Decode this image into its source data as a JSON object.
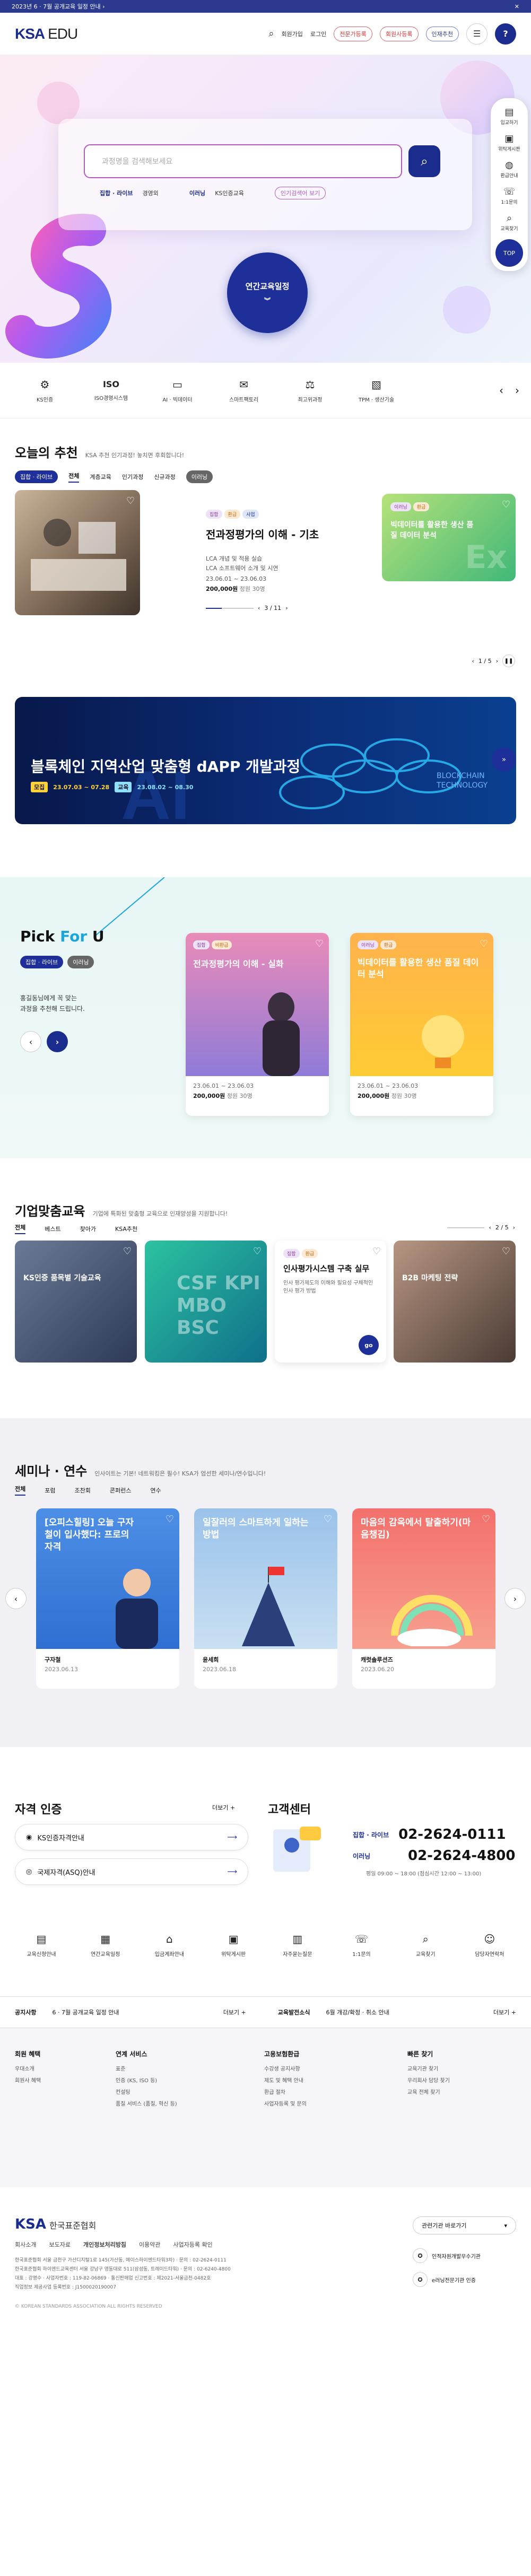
{
  "topbar": {
    "notice": "2023년 6 · 7월 공개교육 일정 안내 ›",
    "close": "✕"
  },
  "header": {
    "logo_main": "KSA",
    "logo_sub": "EDU",
    "menu": [
      "회원가입",
      "로그인"
    ],
    "pill1": "전문가등록",
    "pill2": "회원사등록",
    "pill3": "인재추천",
    "help": "?"
  },
  "hero": {
    "placeholder": "과정명을 검색해보세요",
    "tags": [
      "집합 · 라이브",
      "경영외",
      "이러닝",
      "KS인증교육"
    ],
    "tag_btn": "인기검색어 보기",
    "year_btn": "연간교육일정",
    "year_arrow": "︾"
  },
  "sidebar": [
    {
      "icon": "▤",
      "label": "입교하기"
    },
    {
      "icon": "▣",
      "label": "위탁게시판"
    },
    {
      "icon": "◍",
      "label": "환급안내"
    },
    {
      "icon": "☏",
      "label": "1:1문의"
    },
    {
      "icon": "⌕",
      "label": "교육찾기"
    }
  ],
  "sidebar_top": "TOP",
  "categories": [
    {
      "icon": "⚙",
      "label": "KS인증"
    },
    {
      "icon": "ISO",
      "label": "ISO경영시스템"
    },
    {
      "icon": "▭",
      "label": "AI · 빅데이터"
    },
    {
      "icon": "✉",
      "label": "스마트팩토리"
    },
    {
      "icon": "⚖",
      "label": "최고위과정"
    },
    {
      "icon": "▧",
      "label": "TPM · 생산기술"
    }
  ],
  "today": {
    "title": "오늘의 추천",
    "subtitle": "KSA 추천 인기과정! 놓치면 후회합니다!",
    "sel1": "집합 · 라이브",
    "sel2": "이러닝",
    "tabs": [
      "전체",
      "계층교육",
      "인기과정",
      "신규과정"
    ],
    "main": {
      "badges": [
        "집합",
        "환급",
        "사업"
      ],
      "title": "전과정평가의 이해 - 기초",
      "desc1": "LCA 개념 및 적용 실습",
      "desc2": "LCA 소프트웨어 소개 및 시연",
      "date": "23.06.01 ~ 23.06.03",
      "price": "200,000원",
      "hours": "정원 30명",
      "page": "3 / 11"
    },
    "side": {
      "badges": [
        "이러닝",
        "환급"
      ],
      "title": "빅데이터를 활용한 생산 품질 데이터 분석"
    },
    "pager": "1 / 5"
  },
  "banner": {
    "title": "블록체인 지역산업 맞춤형 dAPP 개발과정",
    "tag1": "모집",
    "date1": "23.07.03 ~ 07.28",
    "tag2": "교육",
    "date2": "23.08.02 ~ 08.30",
    "bg_text": "BLOCKCHAIN TECHNOLOGY"
  },
  "pick": {
    "title_a": "Pick ",
    "title_b": "For ",
    "title_c": "U",
    "sel1": "집합 · 라이브",
    "sel2": "이러닝",
    "desc1": "홍길동님에게 꼭 맞는",
    "desc2": "과정을 추천해 드립니다.",
    "cards": [
      {
        "badges": [
          "집합",
          "비환급"
        ],
        "title": "전과정평가의 이해 - 실화",
        "date": "23.06.01 ~ 23.06.03",
        "price": "200,000원",
        "cap": "정원 30명"
      },
      {
        "badges": [
          "이러닝",
          "환급"
        ],
        "title": "빅데이터를 활용한 생산 품질 데이터 분석",
        "date": "23.06.01 ~ 23.06.03",
        "price": "200,000원",
        "cap": "정원 30명"
      }
    ]
  },
  "corp": {
    "title": "기업맞춤교육",
    "sub": "기업에 특화된 맞춤형 교육으로 인재양성을 지원합니다!",
    "tabs": [
      "전체",
      "베스트",
      "찾아가",
      "KSA추천"
    ],
    "page": "2 / 5",
    "cards": [
      {
        "title": "KS인증 품목별 기술교육"
      },
      {
        "title": "CSF KPI MBO BSC"
      },
      {
        "badges": [
          "집합",
          "환급"
        ],
        "title": "인사평가시스템 구축 실무",
        "desc": "인사 평가제도의 이해와 필요성 구체적인 인사 평가 방법",
        "go": "go"
      },
      {
        "title": "B2B 마케팅 전략"
      }
    ]
  },
  "seminar": {
    "title": "세미나 · 연수",
    "sub": "인사이트는 기본! 네트워킹은 필수! KSA가 엄선한 세미나/연수입니다!",
    "tabs": [
      "전체",
      "포럼",
      "조찬회",
      "콘퍼런스",
      "연수"
    ],
    "cards": [
      {
        "title": "[오피스힐링] 오늘 구자철이 입사했다: 프로의 자격",
        "name": "구자철",
        "date": "2023.06.13"
      },
      {
        "title": "일잘러의 스마트하게 일하는 방법",
        "name": "윤세희",
        "date": "2023.06.18"
      },
      {
        "title": "마음의 감옥에서 탈출하기(마음챙김)",
        "name": "캐럿솔루션즈",
        "date": "2023.06.20"
      }
    ]
  },
  "cert": {
    "title": "자격 인증",
    "more": "더보기 +",
    "items": [
      "KS인증자격안내",
      "국제자격(ASQ)안내"
    ]
  },
  "center": {
    "title": "고객센터",
    "l1": "집합 · 라이브",
    "p1": "02-2624-0111",
    "l2": "이러닝",
    "p2": "02-2624-4800",
    "hours": "평일 09:00 ~ 18:00 (점심시간 12:00 ~ 13:00)"
  },
  "quick": [
    "교육신청안내",
    "연간교육일정",
    "입금계좌안내",
    "위탁게시판",
    "자주묻는질문",
    "1:1문의",
    "교육찾기",
    "담당자연락처"
  ],
  "notices": {
    "l1": "공지사항",
    "t1": "6 · 7월 공개교육 일정 안내",
    "m1": "더보기 +",
    "l2": "교육발전소식",
    "t2": "6월 개강/확정 · 취소 안내",
    "m2": "더보기 +"
  },
  "footnav": [
    {
      "h": "회원 혜택",
      "items": [
        "우대소개",
        "회원사 혜택"
      ]
    },
    {
      "h": "연계 서비스",
      "items": [
        "표준",
        "인증 (KS, ISO 등)",
        "컨설팅",
        "품질 서비스 (품질, 혁신 등)"
      ]
    },
    {
      "h": "고용보험환급",
      "items": [
        "수강생 공지사항",
        "제도 및 혜택 안내",
        "환급 절차",
        "사업자등록 및 문의"
      ]
    },
    {
      "h": "빠른 찾기",
      "items": [
        "교육기관 찾기",
        "우리회사 담당 찾기",
        "교육 전체 찾기"
      ]
    }
  ],
  "footer": {
    "logo": "KSA",
    "org": "한국표준협회",
    "links": [
      "회사소개",
      "보도자료",
      "개인정보처리방침",
      "이용약관",
      "사업자등록 확인"
    ],
    "select": "관련기관 바로가기",
    "addr1": "한국표준협회 서울 금천구 가산디지털1로 145(가산동, 에이스하이엔드타워3차) · 문의 : 02-2624-0111",
    "addr2": "한국표준협회 하이엔드교육센터 서울 강남구 영동대로 511(삼성동, 트레이드타워) · 문의 : 02-6240-4800",
    "addr3": "대표 : 강명수 · 사업자번호 : 119-82-06869 · 통신판매업 신고번호 : 제2021-서울금천-0482호",
    "addr4": "직업정보 제공사업 등록번호 : J1500020190007",
    "copy": "© KOREAN STANDARDS ASSOCIATION ALL RIGHTS RESERVED",
    "cert1": "인적자원개발우수기관",
    "cert2": "e러닝전문기관 인증"
  }
}
